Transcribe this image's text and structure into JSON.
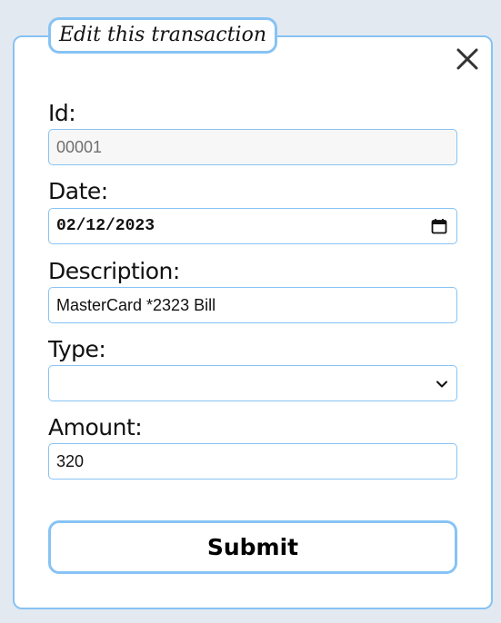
{
  "dialog": {
    "title": "Edit this transaction",
    "close_icon": "close-icon"
  },
  "fields": {
    "id": {
      "label": "Id:",
      "value": "00001"
    },
    "date": {
      "label": "Date:",
      "value": "02/12/2023",
      "icon": "calendar-icon"
    },
    "description": {
      "label": "Description:",
      "value": "MasterCard *2323 Bill"
    },
    "type": {
      "label": "Type:",
      "value": "",
      "icon": "chevron-down-icon"
    },
    "amount": {
      "label": "Amount:",
      "value": "320"
    }
  },
  "submit": {
    "label": "Submit"
  },
  "colors": {
    "accent_border": "#87c3f4",
    "page_background": "#e3e9f1",
    "dialog_background": "#ffffff"
  }
}
